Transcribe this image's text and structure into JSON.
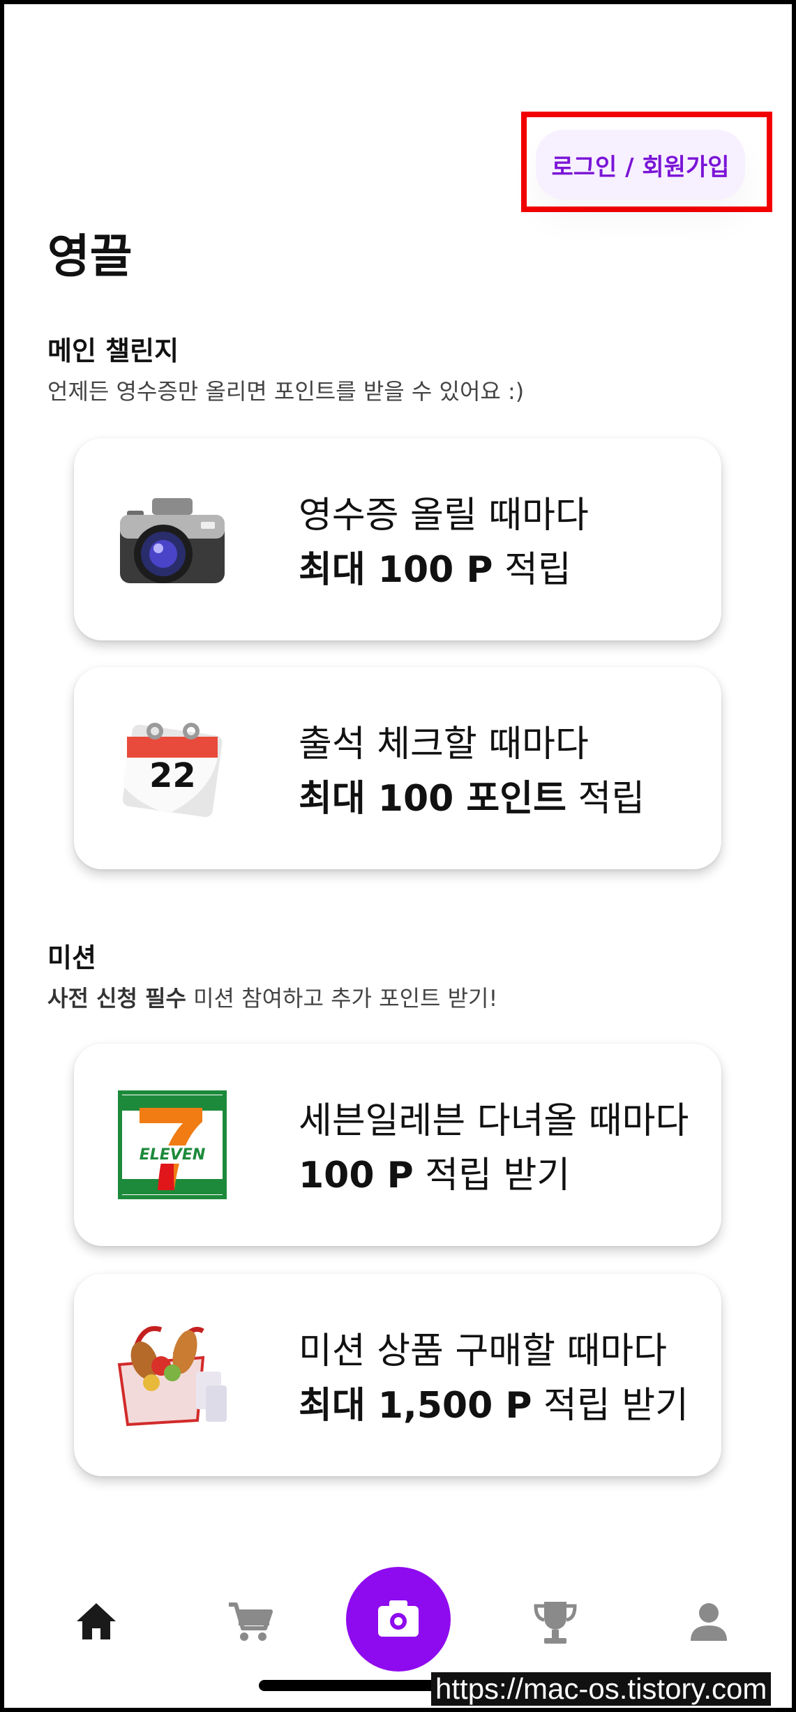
{
  "header": {
    "login_label": "로그인 / 회원가입",
    "app_title": "영끌"
  },
  "main_challenge": {
    "title": "메인 챌린지",
    "subtitle": "언제든 영수증만 올리면 포인트를 받을 수 있어요 :)",
    "cards": [
      {
        "icon": "camera-icon",
        "line1": "영수증 올릴 때마다",
        "line2_bold": "최대 100 P",
        "line2_rest": " 적립"
      },
      {
        "icon": "calendar-icon",
        "line1": "출석 체크할 때마다",
        "line2_bold": "최대 100 포인트",
        "line2_rest": " 적립"
      }
    ]
  },
  "mission": {
    "title": "미션",
    "subtitle_bold": "사전 신청 필수",
    "subtitle_rest": " 미션 참여하고 추가 포인트 받기!",
    "cards": [
      {
        "icon": "seven-eleven-logo",
        "line1": "세븐일레븐 다녀올 때마다",
        "line2_bold": "100 P",
        "line2_rest": " 적립 받기"
      },
      {
        "icon": "grocery-basket-icon",
        "line1": "미션 상품 구매할 때마다",
        "line2_bold": "최대 1,500 P",
        "line2_rest": " 적립 받기"
      }
    ]
  },
  "seven_eleven_logo_text": "ELEVEN",
  "calendar_day": "22",
  "bottom_nav": {
    "items": [
      "home-icon",
      "cart-icon",
      "camera-icon",
      "trophy-icon",
      "profile-icon"
    ],
    "accent": "#8f0bef"
  },
  "watermark": "https://mac-os.tistory.com"
}
